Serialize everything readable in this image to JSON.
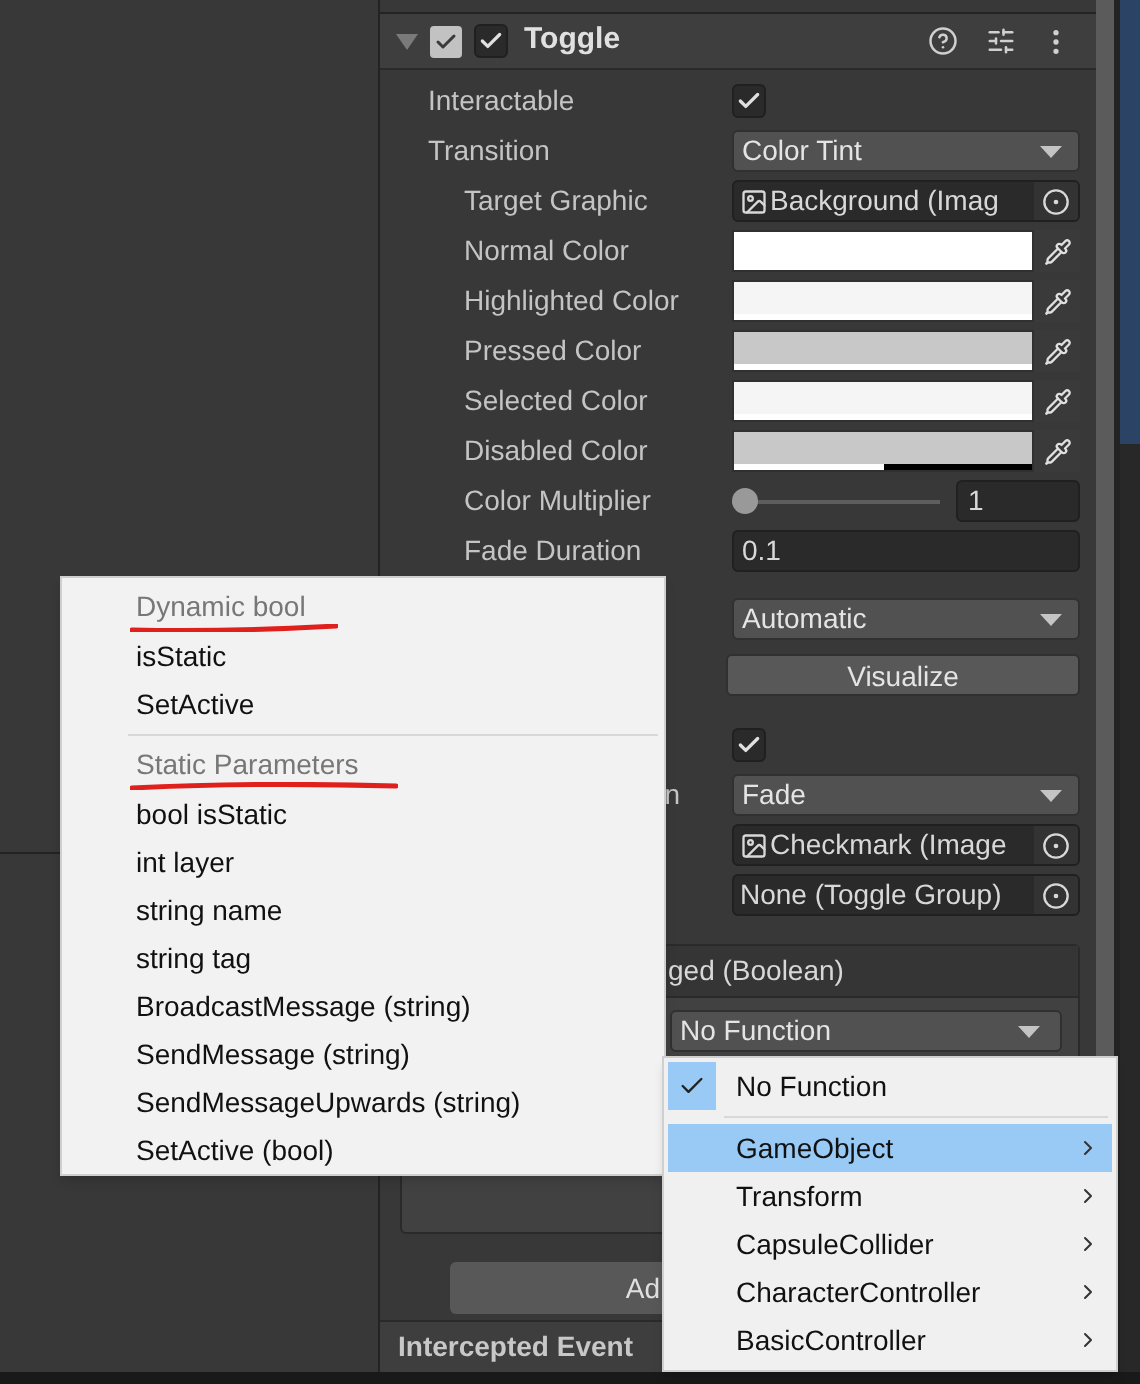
{
  "component": {
    "title": "Toggle",
    "enabled": true,
    "expanded": true
  },
  "properties": [
    {
      "kind": "checkbox",
      "label": "Interactable",
      "checked": true
    },
    {
      "kind": "dropdown",
      "label": "Transition",
      "value": "Color Tint",
      "children": [
        {
          "kind": "image-ref",
          "label": "Target Graphic",
          "value": "Background (Imag"
        },
        {
          "kind": "color",
          "label": "Normal Color",
          "color": "#ffffff",
          "level": 1
        },
        {
          "kind": "color",
          "label": "Highlighted Color",
          "color": "#f5f5f5",
          "level": 1
        },
        {
          "kind": "color",
          "label": "Pressed Color",
          "color": "#c8c8c8",
          "level": 1
        },
        {
          "kind": "color",
          "label": "Selected Color",
          "color": "#f5f5f5",
          "level": 1
        },
        {
          "kind": "color",
          "label": "Disabled Color",
          "color": "#c8c8c8",
          "level": 0.5
        },
        {
          "kind": "slider",
          "label": "Color Multiplier",
          "level": 0,
          "value": "1"
        },
        {
          "kind": "number",
          "label": "Fade Duration",
          "value": "0.1"
        }
      ]
    }
  ],
  "navigation": [
    {
      "kind": "dropdown",
      "value": "Automatic"
    },
    {
      "kind": "button",
      "value": "Visualize"
    }
  ],
  "toggle": [
    {
      "kind": "checkbox",
      "checked": true
    },
    {
      "kind": "dropdown",
      "label": "n",
      "value": "Fade"
    },
    {
      "kind": "image-ref",
      "value": "Checkmark (Image"
    },
    {
      "kind": "object",
      "value": "None (Toggle Group)"
    }
  ],
  "event": {
    "title": "ged (Boolean)",
    "function": "No Function",
    "add_button": "Ad"
  },
  "next_component": "Intercepted Event",
  "parameter_menu": {
    "sections": [
      {
        "title": "Dynamic bool",
        "items": [
          "isStatic",
          "SetActive"
        ]
      },
      {
        "title": "Static Parameters",
        "items": [
          "bool isStatic",
          "int layer",
          "string name",
          "string tag",
          "BroadcastMessage (string)",
          "SendMessage (string)",
          "SendMessageUpwards (string)",
          "SetActive (bool)"
        ]
      }
    ]
  },
  "function_menu": {
    "items": [
      {
        "kind": "check",
        "label": "No Function",
        "checked": true,
        "selected": false
      },
      {
        "kind": "submenu",
        "label": "GameObject",
        "checked": false,
        "selected": true
      },
      {
        "kind": "submenu",
        "label": "Transform",
        "checked": false,
        "selected": false
      },
      {
        "kind": "submenu",
        "label": "CapsuleCollider",
        "checked": false,
        "selected": false
      },
      {
        "kind": "submenu",
        "label": "CharacterController",
        "checked": false,
        "selected": false
      },
      {
        "kind": "submenu",
        "label": "BasicController",
        "checked": false,
        "selected": false
      }
    ]
  }
}
